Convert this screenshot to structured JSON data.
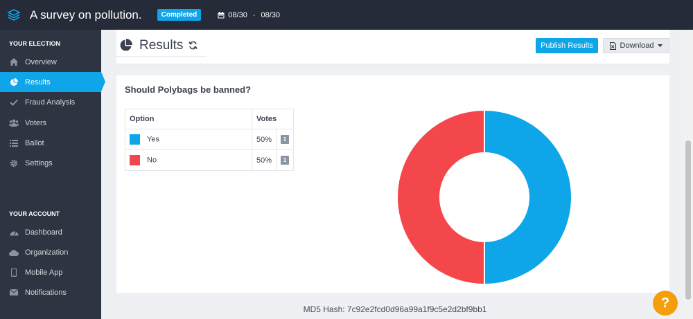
{
  "topbar": {
    "title": "A survey on pollution.",
    "status_badge": "Completed",
    "date_start": "08/30",
    "date_sep": "-",
    "date_end": "08/30"
  },
  "sidebar": {
    "election_heading": "YOUR ELECTION",
    "election_items": [
      {
        "label": "Overview",
        "icon": "home-icon"
      },
      {
        "label": "Results",
        "icon": "pie-chart-icon",
        "active": true
      },
      {
        "label": "Fraud Analysis",
        "icon": "check-icon"
      },
      {
        "label": "Voters",
        "icon": "users-icon"
      },
      {
        "label": "Ballot",
        "icon": "list-icon"
      },
      {
        "label": "Settings",
        "icon": "gear-icon"
      }
    ],
    "account_heading": "YOUR ACCOUNT",
    "account_items": [
      {
        "label": "Dashboard",
        "icon": "dashboard-icon"
      },
      {
        "label": "Organization",
        "icon": "cloud-icon"
      },
      {
        "label": "Mobile App",
        "icon": "mobile-icon"
      },
      {
        "label": "Notifications",
        "icon": "envelope-icon"
      }
    ]
  },
  "header": {
    "page_title": "Results",
    "publish_label": "Publish Results",
    "download_label": "Download"
  },
  "results": {
    "question": "Should Polybags be banned?",
    "col_option": "Option",
    "col_votes": "Votes",
    "rows": [
      {
        "option": "Yes",
        "percent": "50%",
        "count": "1",
        "color": "#0ea5e9"
      },
      {
        "option": "No",
        "percent": "50%",
        "count": "1",
        "color": "#f4474c"
      }
    ]
  },
  "chart_data": {
    "type": "pie",
    "donut": true,
    "categories": [
      "Yes",
      "No"
    ],
    "values": [
      1,
      1
    ],
    "colors": [
      "#0ea5e9",
      "#f4474c"
    ]
  },
  "footer": {
    "md5": "MD5 Hash: 7c92e2fcd0d96a99a1f9c5e2d2bf9bb1"
  },
  "help_label": "?",
  "colors": {
    "accent": "#0ea5e9",
    "topbar": "#252b38",
    "sidebar": "#2e3441",
    "help": "#f59e0b"
  }
}
